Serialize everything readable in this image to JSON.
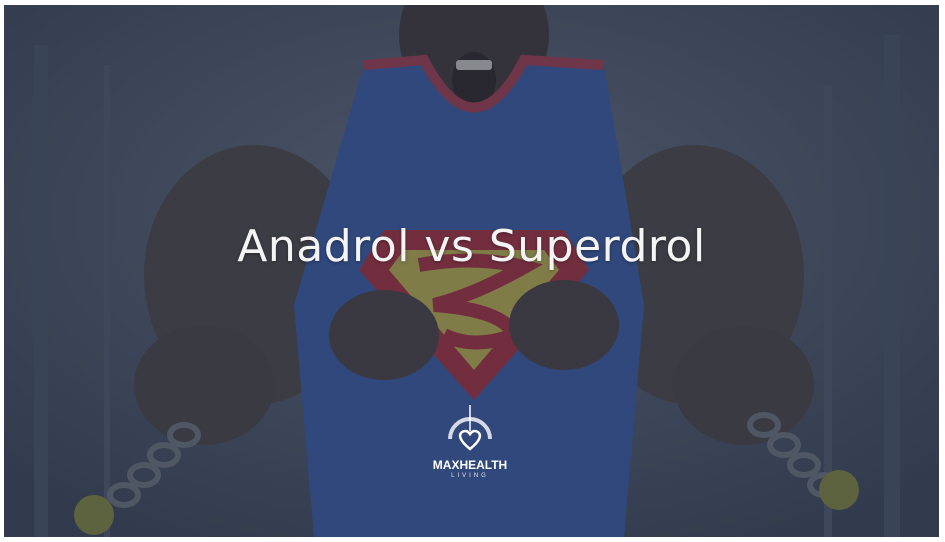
{
  "title": "Anadrol vs Superdrol",
  "logo": {
    "name": "MAXHEALTH",
    "tagline": "LIVING"
  },
  "colors": {
    "overlay": "#283246",
    "title_text": "#f4f4f4",
    "shirt_blue": "#3a5aa8",
    "shirt_trim": "#a83a4a",
    "emblem_red": "#b02a3a",
    "emblem_yellow": "#c8b84a",
    "skin": "#5a4a44"
  }
}
